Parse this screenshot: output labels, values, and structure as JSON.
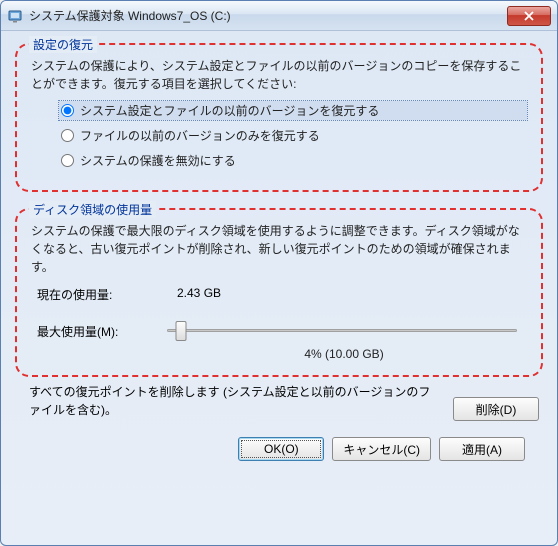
{
  "titlebar": {
    "title": "システム保護対象 Windows7_OS (C:)"
  },
  "restore_group": {
    "legend": "設定の復元",
    "desc": "システムの保護により、システム設定とファイルの以前のバージョンのコピーを保存することができます。復元する項目を選択してください:",
    "options": {
      "opt1": "システム設定とファイルの以前のバージョンを復元する",
      "opt2": "ファイルの以前のバージョンのみを復元する",
      "opt3": "システムの保護を無効にする"
    },
    "selected_index": 0
  },
  "disk_group": {
    "legend": "ディスク領域の使用量",
    "desc": "システムの保護で最大限のディスク領域を使用するように調整できます。ディスク領域がなくなると、古い復元ポイントが削除され、新しい復元ポイントのための領域が確保されます。",
    "current_label": "現在の使用量:",
    "current_value": "2.43 GB",
    "max_label": "最大使用量(M):",
    "slider_percent": 4,
    "slider_text": "4% (10.00 GB)"
  },
  "delete_section": {
    "text": "すべての復元ポイントを削除します (システム設定と以前のバージョンのファイルを含む)。",
    "button": "削除(D)"
  },
  "footer": {
    "ok": "OK(O)",
    "cancel": "キャンセル(C)",
    "apply": "適用(A)"
  }
}
